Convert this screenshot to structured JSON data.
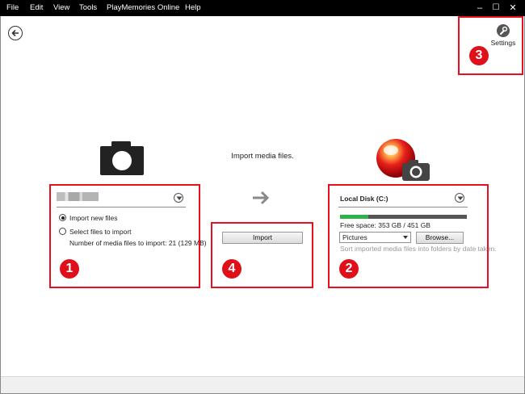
{
  "menubar": {
    "items": [
      "File",
      "Edit",
      "View",
      "Tools",
      "PlayMemories Online",
      "Help"
    ],
    "minimize": "–",
    "maximize": "☐",
    "close": "✕"
  },
  "settings": {
    "label": "Settings"
  },
  "header": {
    "title": "Import media files."
  },
  "source": {
    "import_new_label": "Import new files",
    "select_files_label": "Select files to import",
    "media_count_label": "Number of media files to import: 21 (129 MB)",
    "selected_option": "Import new files"
  },
  "import_button": {
    "label": "Import"
  },
  "destination": {
    "drive_label": "Local Disk (C:)",
    "free_space_label": "Free space: 353 GB / 451 GB",
    "used_fraction": 0.22,
    "folder_value": "Pictures",
    "browse_label": "Browse...",
    "sort_hint": "Sort imported media files into folders by date taken."
  },
  "annotations": {
    "badge1": "1",
    "badge2": "2",
    "badge3": "3",
    "badge4": "4",
    "highlight_color": "#e8101e"
  },
  "icons": [
    "back-arrow-icon",
    "wrench-icon",
    "camera-icon",
    "playmemories-icon",
    "dropdown-icon",
    "arrow-right-icon"
  ]
}
